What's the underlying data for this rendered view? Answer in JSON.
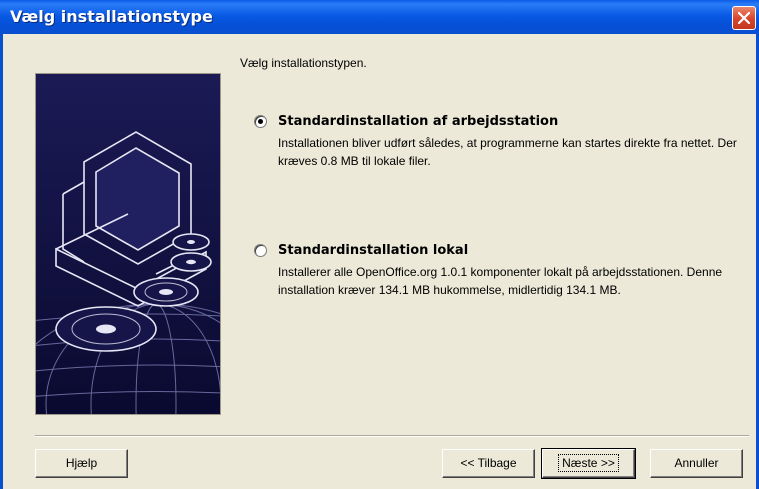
{
  "window": {
    "title": "Vælg installationstype",
    "close_icon": "close-icon"
  },
  "main": {
    "prompt": "Vælg installationstypen.",
    "options": [
      {
        "label": "Standardinstallation af arbejdsstation",
        "description": "Installationen bliver udført således, at programmerne kan startes direkte fra nettet. Der kræves 0.8 MB til lokale filer.",
        "selected": true
      },
      {
        "label": "Standardinstallation lokal",
        "description": "Installerer alle OpenOffice.org 1.0.1 komponenter lokalt på arbejdsstationen. Denne installation kræver 134.1 MB hukommelse, midlertidig 134.1 MB.",
        "selected": false
      }
    ]
  },
  "buttons": {
    "help": "Hjælp",
    "back": "<< Tilbage",
    "next": "Næste >>",
    "cancel": "Annuller"
  },
  "colors": {
    "titlebar": "#0a5ce8",
    "dialog_bg": "#ece9d8",
    "art_bg": "#0d0d3a"
  }
}
